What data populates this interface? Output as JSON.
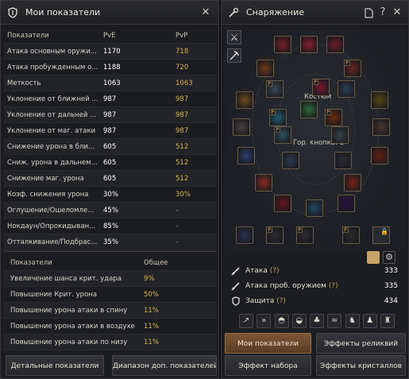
{
  "left": {
    "title": "Мои показатели",
    "header": {
      "name": "Показатели",
      "pve": "PvE",
      "pvp": "PvP"
    },
    "rows": [
      {
        "name": "Атака основным оружи...",
        "pve": "1170",
        "pvp": "718"
      },
      {
        "name": "Атака пробужденным о...",
        "pve": "1188",
        "pvp": "720"
      },
      {
        "name": "Меткость",
        "pve": "1063",
        "pvp": "1063"
      },
      {
        "name": "Уклонение от ближней ...",
        "pve": "987",
        "pvp": "987"
      },
      {
        "name": "Уклонение от дальней ...",
        "pve": "987",
        "pvp": "987"
      },
      {
        "name": "Уклонение от маг. атаки",
        "pve": "987",
        "pvp": "987"
      },
      {
        "name": "Снижение урона в бли...",
        "pve": "605",
        "pvp": "512"
      },
      {
        "name": "Сниж. урона в дальнем...",
        "pve": "605",
        "pvp": "512"
      },
      {
        "name": "Снижение маг. урона",
        "pve": "605",
        "pvp": "512"
      },
      {
        "name": "Коэф. снижения урона",
        "pve": "30%",
        "pvp": "30%"
      },
      {
        "name": "Оглушение/Ошеломле...",
        "pve": "45%",
        "pvp": "–"
      },
      {
        "name": "Нокдаун/Опрокидыван...",
        "pve": "85%",
        "pvp": "–"
      },
      {
        "name": "Отталкивание/Подбрас...",
        "pve": "35%",
        "pvp": "–"
      }
    ],
    "header2": {
      "name": "Показатели",
      "val": "Общее"
    },
    "rows2": [
      {
        "name": "Увеличение шанса крит. удара",
        "val": "9%"
      },
      {
        "name": "Повышение Крит. урона",
        "val": "50%"
      },
      {
        "name": "Повышение урона атаки в спину",
        "val": "11%"
      },
      {
        "name": "Повышение урона атаки в воздухе",
        "val": "11%"
      },
      {
        "name": "Повышение урона атаки по низу",
        "val": "11%"
      }
    ],
    "btn_details": "Детальные показатели",
    "btn_range": "Диапазон доп. показателей"
  },
  "right": {
    "title": "Снаряжение",
    "costume_label": "Костюм",
    "hotkey_label": "Гор. кнопка: U",
    "attack_label": "Атака",
    "attack_q": "(?)",
    "attack_val": "333",
    "awak_label": "Атака проб. оружием",
    "awak_q": "(?)",
    "awak_val": "335",
    "def_label": "Защита",
    "def_q": "(?)",
    "def_val": "434",
    "tab_stats": "Мои показатели",
    "tab_relic": "Эффекты реликвий",
    "tab_set": "Эффект набора",
    "tab_crystal": "Эффекты кристаллов",
    "slot_tag": "P"
  },
  "colors": {
    "accent": "#d9b24c",
    "panel": "#1c1d21",
    "active_tab": "#6b4a2e"
  }
}
